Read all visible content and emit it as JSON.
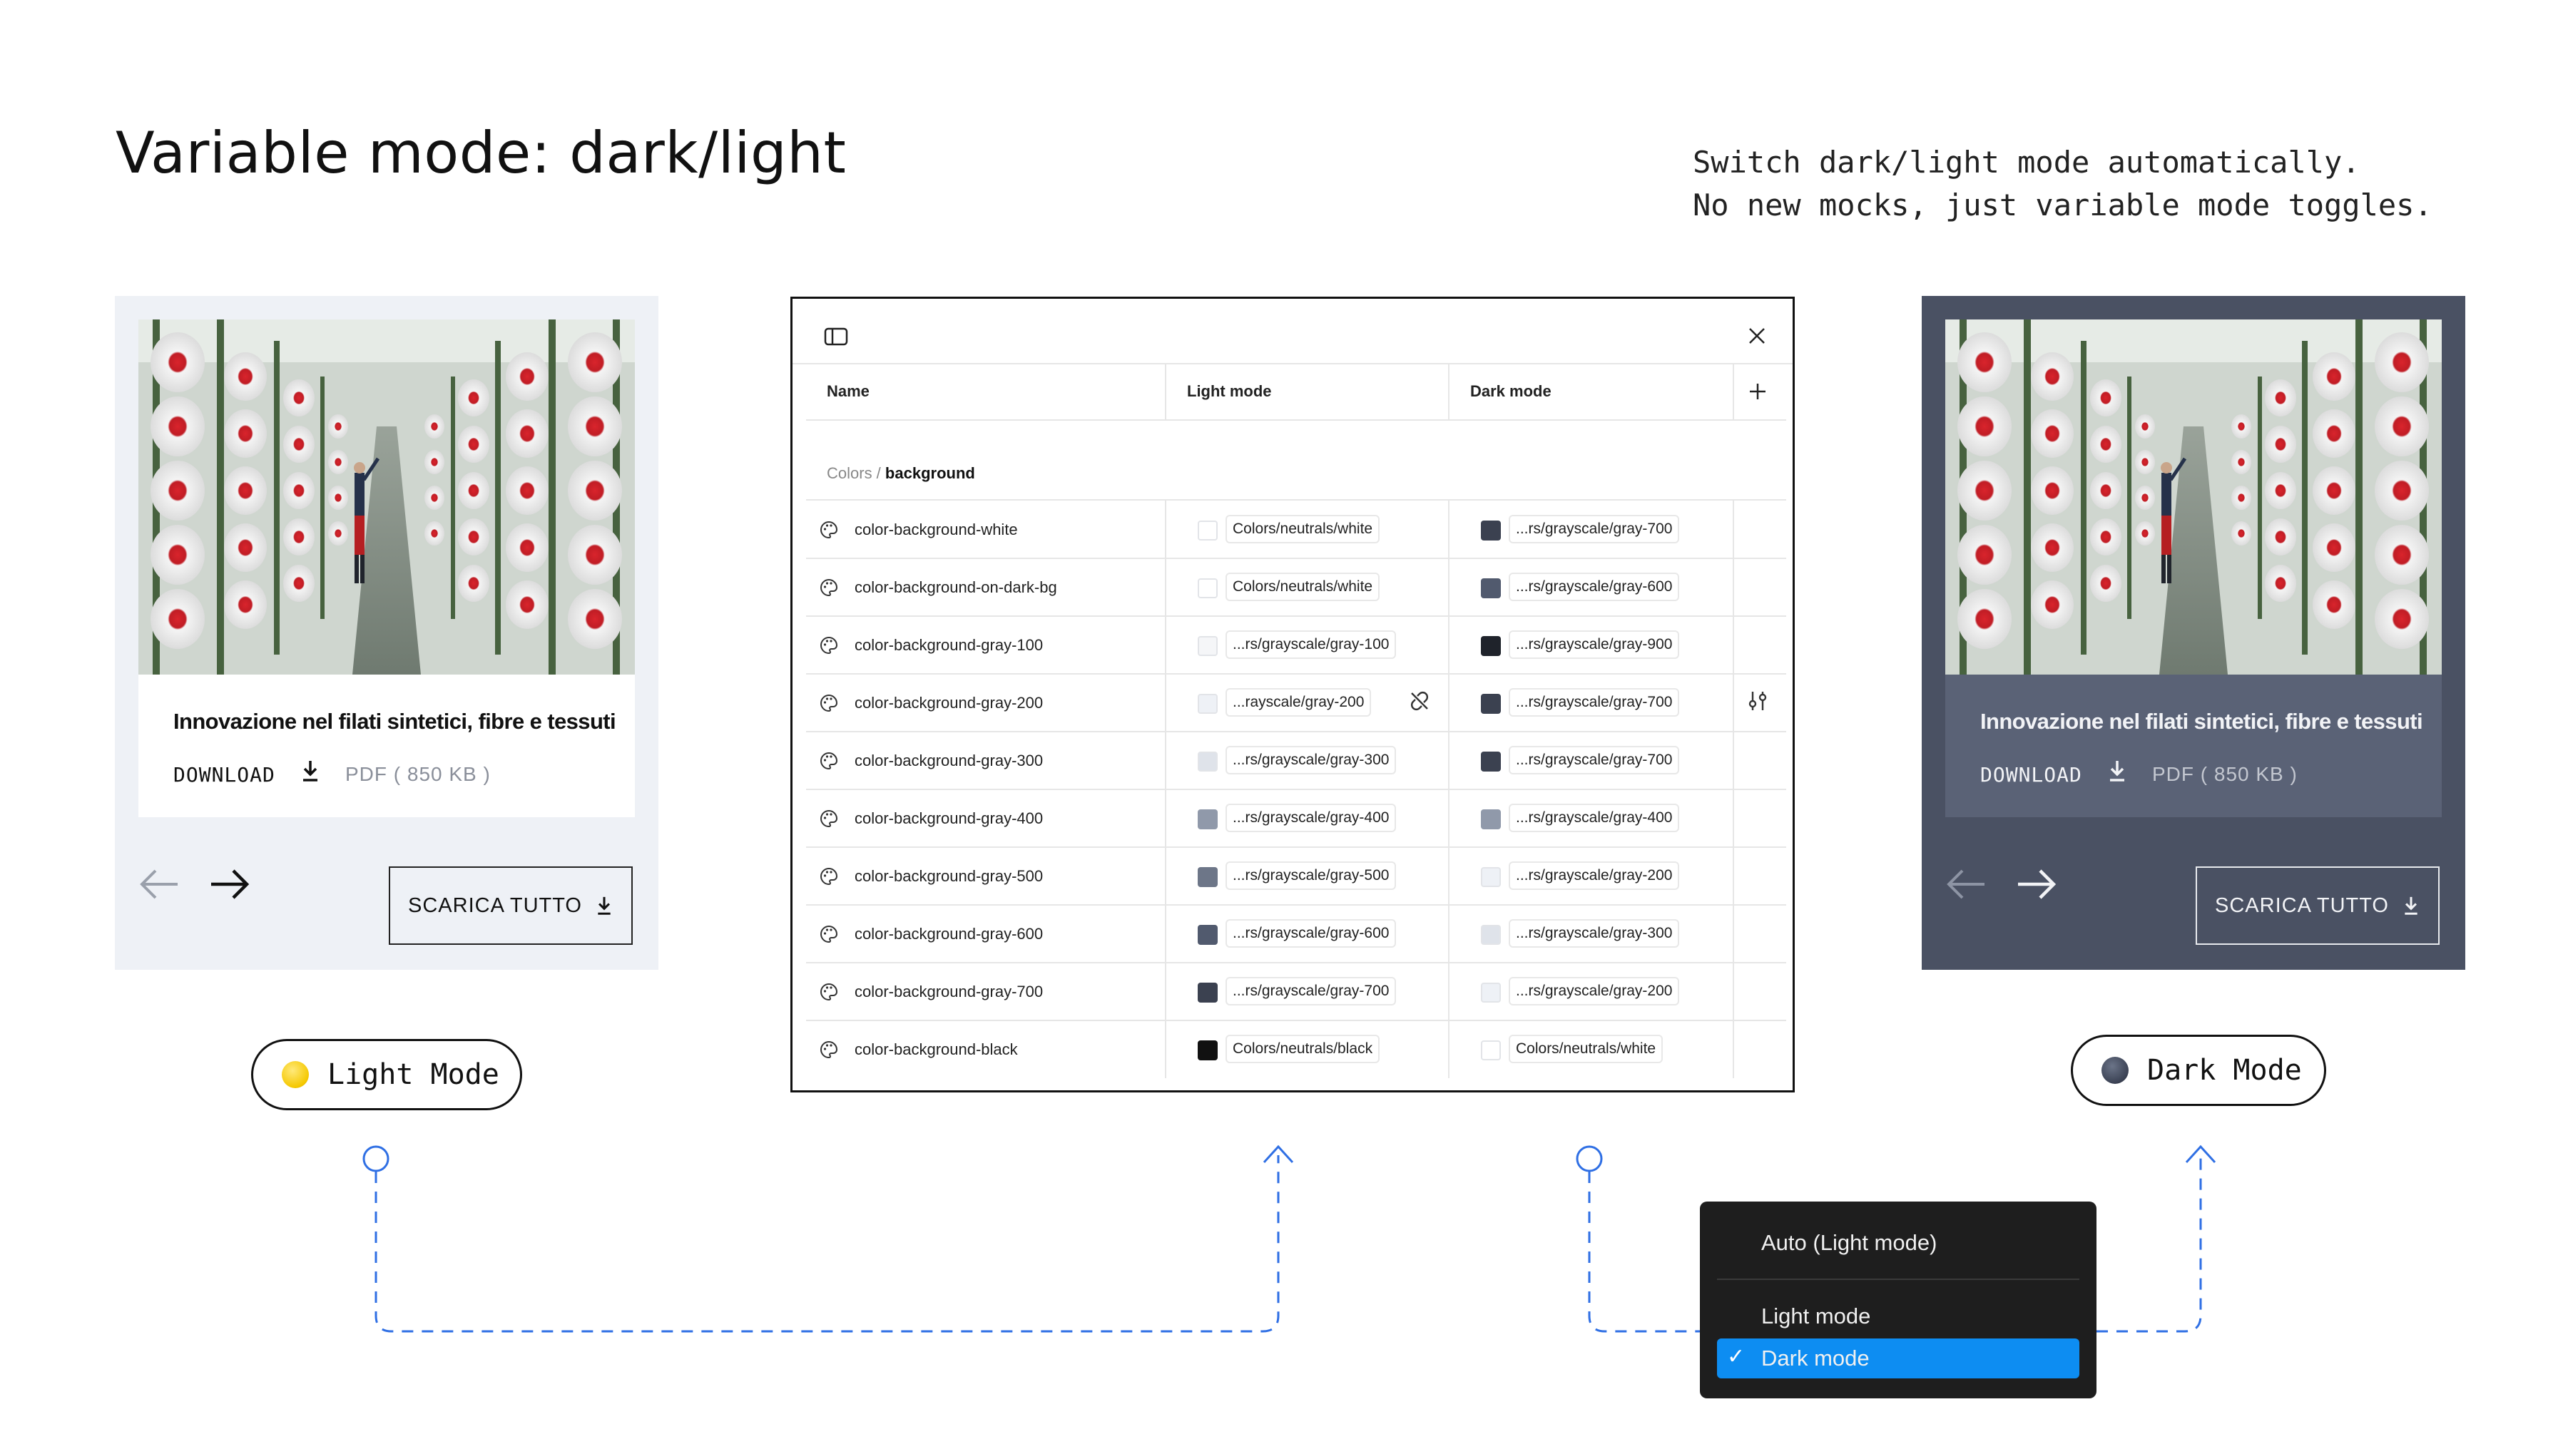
{
  "title": "Variable mode: dark/light",
  "tagline": "Switch dark/light mode automatically.\nNo new mocks, just variable mode toggles.",
  "card": {
    "title": "Innovazione nel filati sintetici, fibre e tessuti",
    "download_label": "DOWNLOAD",
    "file_size": "PDF ( 850 KB )",
    "scarica_label": "SCARICA TUTTO",
    "photo_icon": "textile-factory-photo"
  },
  "modes": {
    "light_label": "Light Mode",
    "dark_label": "Dark Mode"
  },
  "colors": {
    "light_panel": "#eef1f6",
    "dark_panel": "#4a5163",
    "accent_blue": "#2f6fe4",
    "menu_selected": "#0d8df2"
  },
  "table": {
    "columns": [
      "Name",
      "Light mode",
      "Dark mode"
    ],
    "breadcrumb_group": "Colors /",
    "breadcrumb_leaf": "background",
    "rows": [
      {
        "name": "color-background-white",
        "light": "Colors/neutrals/white",
        "light_color": "#ffffff",
        "dark": "...rs/grayscale/gray-700",
        "dark_color": "#3b4150"
      },
      {
        "name": "color-background-on-dark-bg",
        "light": "Colors/neutrals/white",
        "light_color": "#ffffff",
        "dark": "...rs/grayscale/gray-600",
        "dark_color": "#515a6e"
      },
      {
        "name": "color-background-gray-100",
        "light": "...rs/grayscale/gray-100",
        "light_color": "#f5f6f8",
        "dark": "...rs/grayscale/gray-900",
        "dark_color": "#1f232b"
      },
      {
        "name": "color-background-gray-200",
        "light": "...rayscale/gray-200",
        "light_color": "#eef1f6",
        "dark": "...rs/grayscale/gray-700",
        "dark_color": "#3b4150"
      },
      {
        "name": "color-background-gray-300",
        "light": "...rs/grayscale/gray-300",
        "light_color": "#dfe3ea",
        "dark": "...rs/grayscale/gray-700",
        "dark_color": "#3b4150"
      },
      {
        "name": "color-background-gray-400",
        "light": "...rs/grayscale/gray-400",
        "light_color": "#9099aa",
        "dark": "...rs/grayscale/gray-400",
        "dark_color": "#9099aa"
      },
      {
        "name": "color-background-gray-500",
        "light": "...rs/grayscale/gray-500",
        "light_color": "#6d7688",
        "dark": "...rs/grayscale/gray-200",
        "dark_color": "#eef1f6"
      },
      {
        "name": "color-background-gray-600",
        "light": "...rs/grayscale/gray-600",
        "light_color": "#515a6e",
        "dark": "...rs/grayscale/gray-300",
        "dark_color": "#dfe3ea"
      },
      {
        "name": "color-background-gray-700",
        "light": "...rs/grayscale/gray-700",
        "light_color": "#3b4150",
        "dark": "...rs/grayscale/gray-200",
        "dark_color": "#eef1f6"
      },
      {
        "name": "color-background-black",
        "light": "Colors/neutrals/black",
        "light_color": "#111111",
        "dark": "Colors/neutrals/white",
        "dark_color": "#ffffff"
      }
    ]
  },
  "menu": {
    "items": [
      "Auto (Light mode)",
      "Light mode",
      "Dark mode"
    ],
    "selected": "Dark mode",
    "check": "✓"
  }
}
